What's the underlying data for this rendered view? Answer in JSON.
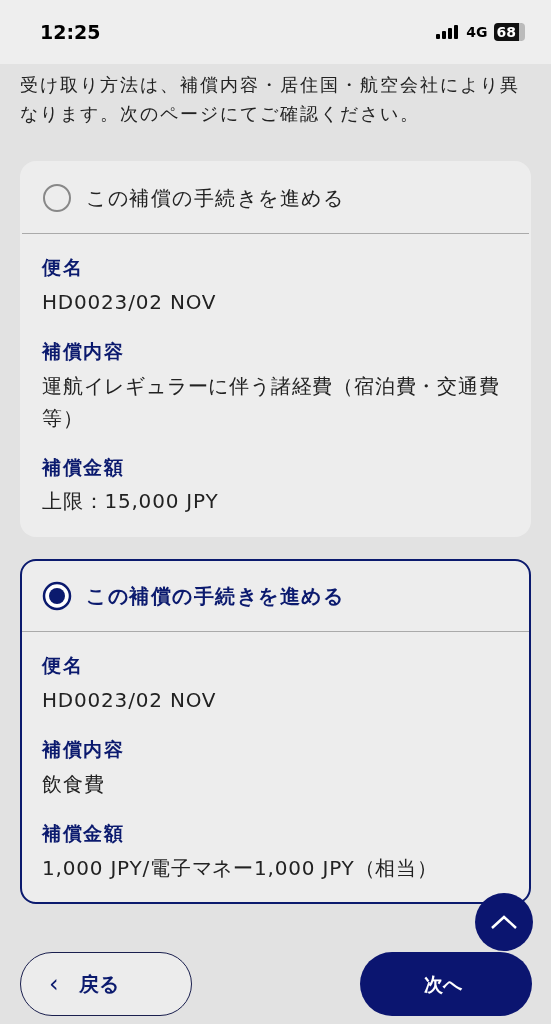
{
  "status_bar": {
    "time": "12:25",
    "network": "4G",
    "battery": "68"
  },
  "intro": "受け取り方法は、補償内容・居住国・航空会社により異なります。次のページにてご確認ください。",
  "options": [
    {
      "label": "この補償の手続きを進める",
      "selected": false,
      "fields": [
        {
          "label": "便名",
          "value": "HD0023/02 NOV"
        },
        {
          "label": "補償内容",
          "value": "運航イレギュラーに伴う諸経費（宿泊費・交通費等）"
        },
        {
          "label": "補償金額",
          "value": "上限：15,000 JPY"
        }
      ]
    },
    {
      "label": "この補償の手続きを進める",
      "selected": true,
      "fields": [
        {
          "label": "便名",
          "value": "HD0023/02 NOV"
        },
        {
          "label": "補償内容",
          "value": "飲食費"
        },
        {
          "label": "補償金額",
          "value": "1,000 JPY/電子マネー1,000 JPY（相当）"
        }
      ]
    }
  ],
  "back_button": {
    "icon": "‹",
    "label": "戻る"
  },
  "next_button": {
    "label": "次へ"
  }
}
